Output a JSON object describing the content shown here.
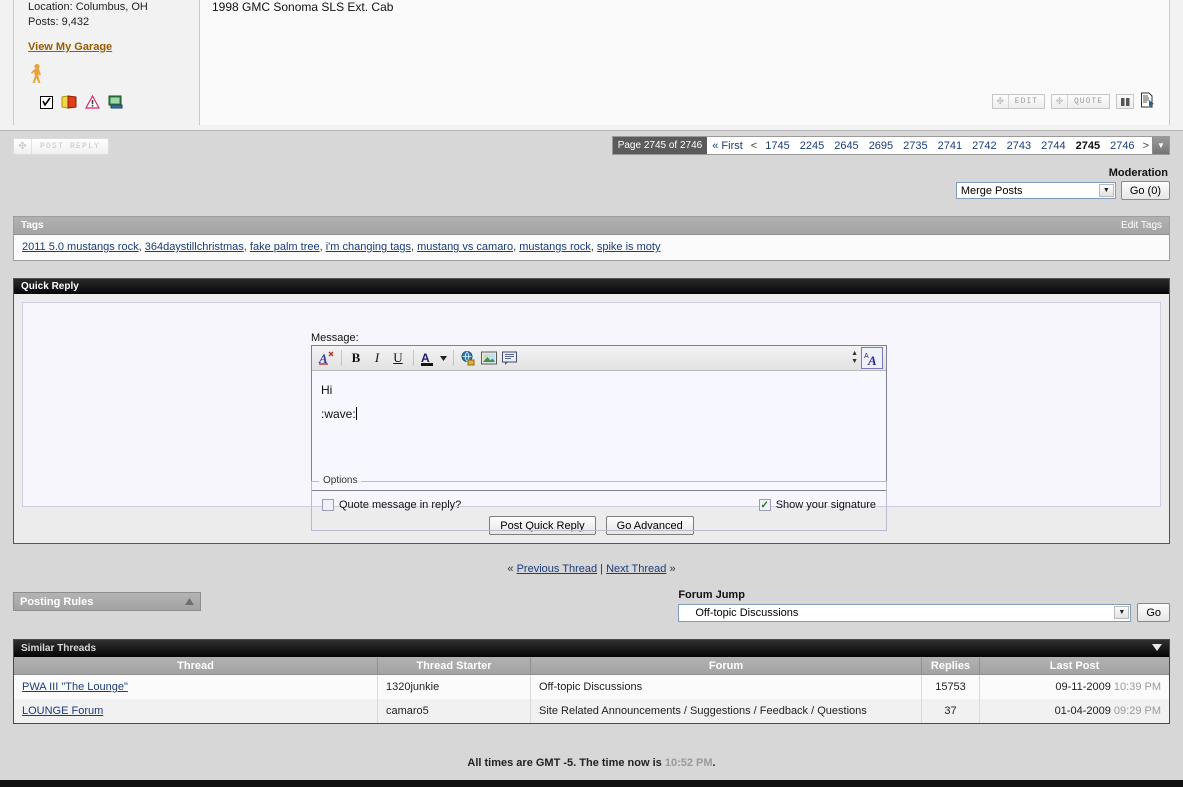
{
  "post": {
    "location_line": "Location: Columbus, OH",
    "posts_line": "Posts: 9,432",
    "garage_link": "View My Garage",
    "signature": "1998 GMC Sonoma SLS Ext. Cab",
    "controls": {
      "edit_label": "EDIT",
      "quote_label": "QUOTE"
    },
    "status_icons": [
      "checkbox-icon",
      "book-icon",
      "warning-icon",
      "monitor-icon"
    ],
    "walk_icon": "walking-person-icon"
  },
  "toolbar": {
    "post_reply_label": "POST REPLY"
  },
  "pagination": {
    "title": "Page 2745 of 2746",
    "first_label": "« First",
    "prev_label": "<",
    "next_label": ">",
    "pages": [
      "1745",
      "2245",
      "2645",
      "2695",
      "2735",
      "2741",
      "2742",
      "2743",
      "2744",
      "2745",
      "2746"
    ],
    "current": "2745",
    "dropdown_icon": "chevron-down-icon"
  },
  "moderation": {
    "title": "Moderation",
    "selected": "Merge Posts",
    "go_label": "Go (0)"
  },
  "tags": {
    "header": "Tags",
    "edit_label": "Edit Tags",
    "items": [
      "2011 5.0 mustangs rock",
      "364daystillchristmas",
      "fake palm tree",
      "i'm changing tags",
      "mustang vs camaro",
      "mustangs rock",
      "spike is moty"
    ]
  },
  "quick_reply": {
    "header": "Quick Reply",
    "message_label": "Message:",
    "editor_icons": [
      "remove-format-icon",
      "bold-icon",
      "italic-icon",
      "underline-icon",
      "font-color-icon",
      "insert-link-icon",
      "insert-image-icon",
      "insert-quote-icon"
    ],
    "message_line1": "Hi",
    "message_line2": ":wave:",
    "options_legend": "Options",
    "quote_option_label": "Quote message in reply?",
    "quote_option_checked": false,
    "signature_option_label": "Show your signature",
    "signature_option_checked": true,
    "signature_check_glyph": "✓",
    "post_button": "Post Quick Reply",
    "advanced_button": "Go Advanced"
  },
  "thread_nav": {
    "prev_arrow": "«",
    "prev_label": "Previous Thread",
    "divider": "|",
    "next_label": "Next Thread",
    "next_arrow": "»"
  },
  "posting_rules": {
    "label": "Posting Rules",
    "collapse_icon": "chevron-up-icon"
  },
  "forum_jump": {
    "title": "Forum Jump",
    "selected": "Off-topic Discussions",
    "go_label": "Go"
  },
  "similar_threads": {
    "header": "Similar Threads",
    "collapse_icon": "chevron-down-icon",
    "columns": [
      "Thread",
      "Thread Starter",
      "Forum",
      "Replies",
      "Last Post"
    ],
    "rows": [
      {
        "thread": "PWA III \"The Lounge\"",
        "starter": "1320junkie",
        "forum": "Off-topic Discussions",
        "replies": "15753",
        "last_post_date": "09-11-2009",
        "last_post_time": "10:39 PM"
      },
      {
        "thread": "LOUNGE Forum",
        "starter": "camaro5",
        "forum": "Site Related Announcements / Suggestions / Feedback / Questions",
        "replies": "37",
        "last_post_date": "01-04-2009",
        "last_post_time": "09:29 PM"
      }
    ]
  },
  "footer": {
    "timezone_text": "All times are GMT -5. The time now is ",
    "current_time": "10:52 PM",
    "period": "."
  }
}
